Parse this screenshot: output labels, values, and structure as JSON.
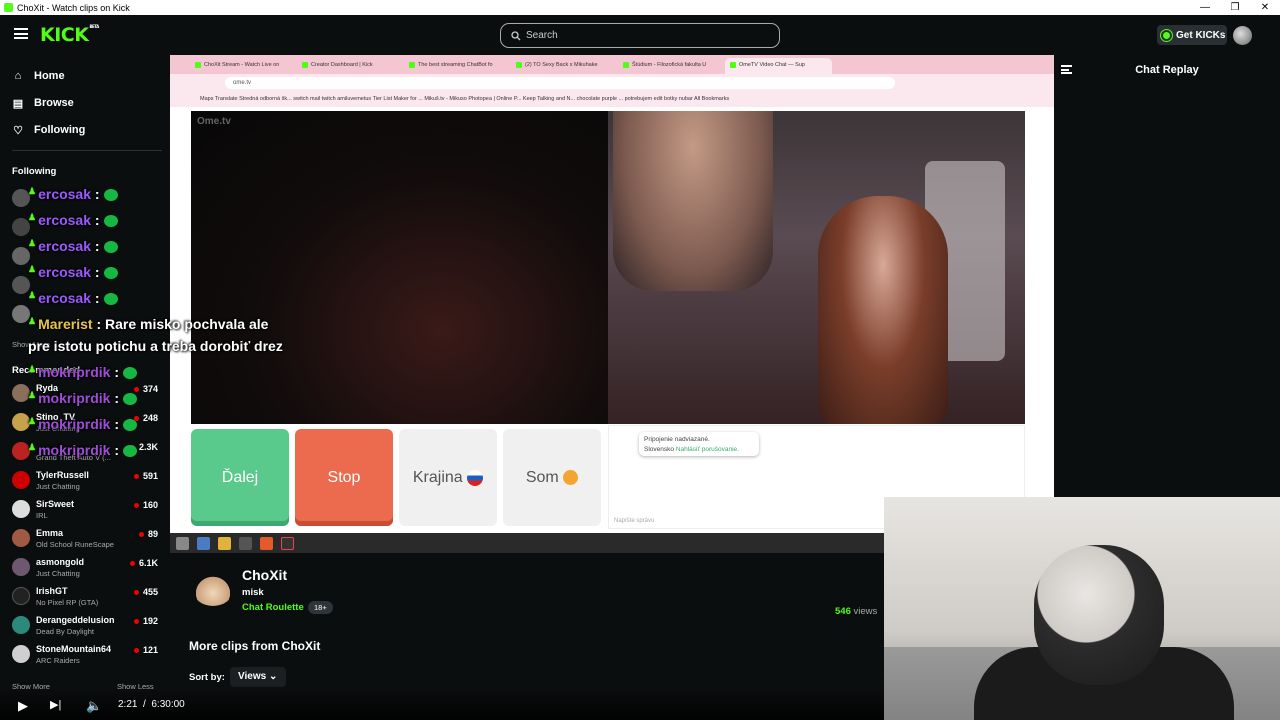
{
  "window": {
    "title": "ChoXit - Watch clips on Kick",
    "min": "—",
    "max": "❐",
    "close": "✕"
  },
  "topbar": {
    "logo": "KICK",
    "logo_badge": "BETA",
    "search_placeholder": "Search",
    "get_kicks": "Get KICKs"
  },
  "sidebar": {
    "nav": [
      {
        "label": "Home",
        "icon": "home-icon"
      },
      {
        "label": "Browse",
        "icon": "browse-icon"
      },
      {
        "label": "Following",
        "icon": "heart-icon"
      }
    ],
    "following_header": "Following",
    "show_more_1": "Show More",
    "recommended_header": "Recommended",
    "recommended": [
      {
        "name": "Ryda",
        "category": "",
        "viewers": "374"
      },
      {
        "name": "Stino_TV",
        "category": "Just Chatting",
        "viewers": "248"
      },
      {
        "name": "",
        "category": "Grand Theft Auto V (...",
        "viewers": "2.3K"
      },
      {
        "name": "TylerRussell",
        "category": "Just Chatting",
        "viewers": "591"
      },
      {
        "name": "SirSweet",
        "category": "IRL",
        "viewers": "160"
      },
      {
        "name": "Emma",
        "category": "Old School RuneScape",
        "viewers": "89"
      },
      {
        "name": "asmongold",
        "category": "Just Chatting",
        "viewers": "6.1K"
      },
      {
        "name": "IrishGT",
        "category": "No Pixel RP (GTA)",
        "viewers": "455"
      },
      {
        "name": "Derangeddelusion",
        "category": "Dead By Daylight",
        "viewers": "192"
      },
      {
        "name": "StoneMountain64",
        "category": "ARC Raiders",
        "viewers": "121"
      }
    ],
    "show_more_2": "Show More",
    "show_less": "Show Less"
  },
  "overlay_chat": [
    {
      "user": "ercosak",
      "msg": ":"
    },
    {
      "user": "ercosak",
      "msg": ":"
    },
    {
      "user": "ercosak",
      "msg": ":"
    },
    {
      "user": "ercosak",
      "msg": ":"
    },
    {
      "user": "ercosak",
      "msg": ":"
    },
    {
      "user": "Marerist",
      "msg": ": Rare misko pochvala ale"
    },
    {
      "user": "",
      "msg": "pre istotu potichu a treba dorobiť drez"
    },
    {
      "user": "mokriprdik",
      "msg": ":"
    },
    {
      "user": "mokriprdik",
      "msg": ":"
    },
    {
      "user": "mokriprdik",
      "msg": ":"
    },
    {
      "user": "mokriprdik",
      "msg": ":"
    }
  ],
  "stream_browser": {
    "tabs": [
      "ChoXit Stream - Watch Live on",
      "Creator Dashboard | Kick",
      "The best streaming ChatBot fo",
      "(2) TO Sexy Back x Mikuhake",
      "Štúdium - Filozofická fakulta U",
      "OmeTV Video Chat — Sup"
    ],
    "url": "ome.tv",
    "bookmarks": "Maps   Translate   Stredná odborná šk...   switch   mail   twitch   amiluvemetus   Tier List Maker for ...   Mikuš.tv - Mikuso   Photopea | Online P...   Keep Talking and N...   chocolate purple ...   potrebujem edit   botky   nubar      All Bookmarks",
    "ometv_logo": "Ome.tv",
    "btn_next": "Ďalej",
    "btn_stop": "Stop",
    "btn_country": "Krajina",
    "btn_som": "Som",
    "msg_line1": "Pripojenie nadviazané.",
    "msg_line2": "Slovensko",
    "msg_link": "Nahlásiť porušovanie.",
    "input_placeholder": "Napíšte správu"
  },
  "chat": {
    "title": "Chat Replay"
  },
  "clip": {
    "channel": "ChoXit",
    "title": "misk",
    "category": "Chat Roulette",
    "age_badge": "18+",
    "views_count": "546",
    "views_label": "views",
    "more_header": "More clips from ChoXit",
    "sort_label": "Sort by:",
    "sort_value": "Views"
  },
  "player": {
    "current": "2:21",
    "separator": "/",
    "duration": "6:30:00"
  },
  "colors": {
    "kick_green": "#53fc18",
    "bg": "#0b0e0f",
    "live_red": "#eb0400"
  }
}
